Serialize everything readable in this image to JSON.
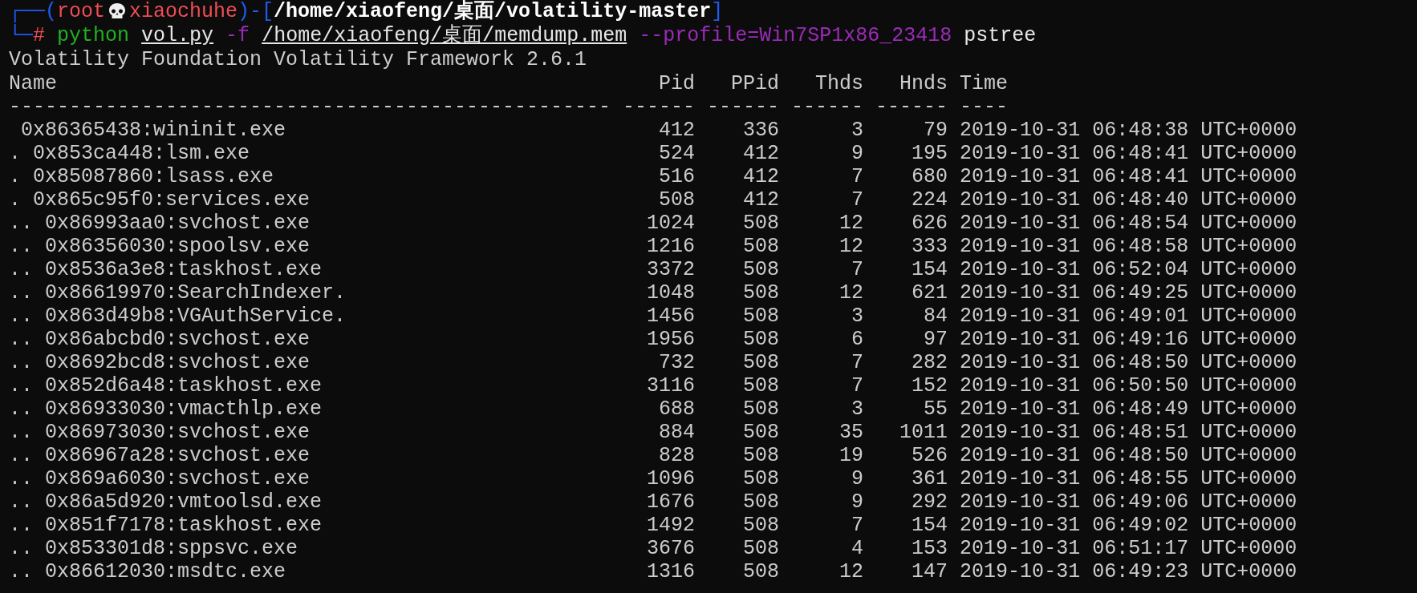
{
  "prompt": {
    "open": "┌──(",
    "user": "root",
    "host": "xiaochuhe",
    "mid": ")-[",
    "cwd": "/home/xiaofeng/桌面/volatility-master",
    "close": "]"
  },
  "command": {
    "corner": "└─",
    "symbol": "#",
    "tokens": [
      {
        "text": "python",
        "kind": "program"
      },
      {
        "text": "vol.py",
        "kind": "path"
      },
      {
        "text": "-f",
        "kind": "option"
      },
      {
        "text": "/home/xiaofeng/桌面/memdump.mem",
        "kind": "path"
      },
      {
        "text": "--profile=Win7SP1x86_23418",
        "kind": "option"
      },
      {
        "text": "pstree",
        "kind": "plain"
      }
    ]
  },
  "banner": "Volatility Foundation Volatility Framework 2.6.1",
  "table": {
    "columns": [
      "Name",
      "Pid",
      "PPid",
      "Thds",
      "Hnds",
      "Time"
    ],
    "separators": [
      "--------------------------------------------------",
      "------",
      "------",
      "------",
      "------",
      "----"
    ],
    "rows": [
      {
        "name": " 0x86365438:wininit.exe",
        "pid": "412",
        "ppid": "336",
        "thds": "3",
        "hnds": "79",
        "time": "2019-10-31 06:48:38 UTC+0000"
      },
      {
        "name": ". 0x853ca448:lsm.exe",
        "pid": "524",
        "ppid": "412",
        "thds": "9",
        "hnds": "195",
        "time": "2019-10-31 06:48:41 UTC+0000"
      },
      {
        "name": ". 0x85087860:lsass.exe",
        "pid": "516",
        "ppid": "412",
        "thds": "7",
        "hnds": "680",
        "time": "2019-10-31 06:48:41 UTC+0000"
      },
      {
        "name": ". 0x865c95f0:services.exe",
        "pid": "508",
        "ppid": "412",
        "thds": "7",
        "hnds": "224",
        "time": "2019-10-31 06:48:40 UTC+0000"
      },
      {
        "name": ".. 0x86993aa0:svchost.exe",
        "pid": "1024",
        "ppid": "508",
        "thds": "12",
        "hnds": "626",
        "time": "2019-10-31 06:48:54 UTC+0000"
      },
      {
        "name": ".. 0x86356030:spoolsv.exe",
        "pid": "1216",
        "ppid": "508",
        "thds": "12",
        "hnds": "333",
        "time": "2019-10-31 06:48:58 UTC+0000"
      },
      {
        "name": ".. 0x8536a3e8:taskhost.exe",
        "pid": "3372",
        "ppid": "508",
        "thds": "7",
        "hnds": "154",
        "time": "2019-10-31 06:52:04 UTC+0000"
      },
      {
        "name": ".. 0x86619970:SearchIndexer.",
        "pid": "1048",
        "ppid": "508",
        "thds": "12",
        "hnds": "621",
        "time": "2019-10-31 06:49:25 UTC+0000"
      },
      {
        "name": ".. 0x863d49b8:VGAuthService.",
        "pid": "1456",
        "ppid": "508",
        "thds": "3",
        "hnds": "84",
        "time": "2019-10-31 06:49:01 UTC+0000"
      },
      {
        "name": ".. 0x86abcbd0:svchost.exe",
        "pid": "1956",
        "ppid": "508",
        "thds": "6",
        "hnds": "97",
        "time": "2019-10-31 06:49:16 UTC+0000"
      },
      {
        "name": ".. 0x8692bcd8:svchost.exe",
        "pid": "732",
        "ppid": "508",
        "thds": "7",
        "hnds": "282",
        "time": "2019-10-31 06:48:50 UTC+0000"
      },
      {
        "name": ".. 0x852d6a48:taskhost.exe",
        "pid": "3116",
        "ppid": "508",
        "thds": "7",
        "hnds": "152",
        "time": "2019-10-31 06:50:50 UTC+0000"
      },
      {
        "name": ".. 0x86933030:vmacthlp.exe",
        "pid": "688",
        "ppid": "508",
        "thds": "3",
        "hnds": "55",
        "time": "2019-10-31 06:48:49 UTC+0000"
      },
      {
        "name": ".. 0x86973030:svchost.exe",
        "pid": "884",
        "ppid": "508",
        "thds": "35",
        "hnds": "1011",
        "time": "2019-10-31 06:48:51 UTC+0000"
      },
      {
        "name": ".. 0x86967a28:svchost.exe",
        "pid": "828",
        "ppid": "508",
        "thds": "19",
        "hnds": "526",
        "time": "2019-10-31 06:48:50 UTC+0000"
      },
      {
        "name": ".. 0x869a6030:svchost.exe",
        "pid": "1096",
        "ppid": "508",
        "thds": "9",
        "hnds": "361",
        "time": "2019-10-31 06:48:55 UTC+0000"
      },
      {
        "name": ".. 0x86a5d920:vmtoolsd.exe",
        "pid": "1676",
        "ppid": "508",
        "thds": "9",
        "hnds": "292",
        "time": "2019-10-31 06:49:06 UTC+0000"
      },
      {
        "name": ".. 0x851f7178:taskhost.exe",
        "pid": "1492",
        "ppid": "508",
        "thds": "7",
        "hnds": "154",
        "time": "2019-10-31 06:49:02 UTC+0000"
      },
      {
        "name": ".. 0x853301d8:sppsvc.exe",
        "pid": "3676",
        "ppid": "508",
        "thds": "4",
        "hnds": "153",
        "time": "2019-10-31 06:51:17 UTC+0000"
      },
      {
        "name": ".. 0x86612030:msdtc.exe",
        "pid": "1316",
        "ppid": "508",
        "thds": "12",
        "hnds": "147",
        "time": "2019-10-31 06:49:23 UTC+0000"
      }
    ]
  }
}
